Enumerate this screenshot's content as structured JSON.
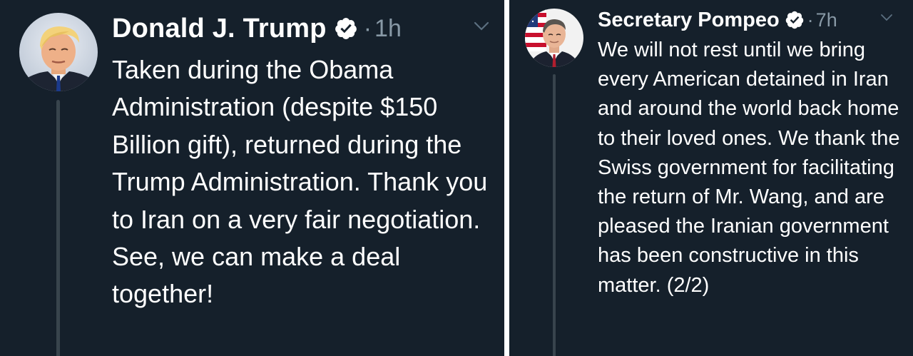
{
  "tweets": [
    {
      "author": "Donald J. Trump",
      "separator": "·",
      "time": "1h",
      "text": "Taken during the Obama Administration (despite $150 Billion gift), returned during the Trump Administration. Thank you to Iran on a very fair negotiation. See, we can make a deal together!",
      "avatar_icon": "portrait-avatar",
      "verified_icon": "verified-badge-icon",
      "menu_icon": "chevron-down-icon"
    },
    {
      "author": "Secretary Pompeo",
      "separator": "·",
      "time": "7h",
      "text": "We will not rest until we bring every American detained in Iran and around the world back home to their loved ones. We thank the Swiss government for facilitating the return of Mr. Wang, and are pleased the Iranian government has been constructive in this matter. (2/2)",
      "avatar_icon": "portrait-with-flag-avatar",
      "verified_icon": "verified-badge-icon",
      "menu_icon": "chevron-down-icon"
    }
  ],
  "colors": {
    "background": "#15202b",
    "text": "#ffffff",
    "secondary_text": "#8899a6",
    "thread_line": "#38444d",
    "divider": "#ffffff"
  }
}
